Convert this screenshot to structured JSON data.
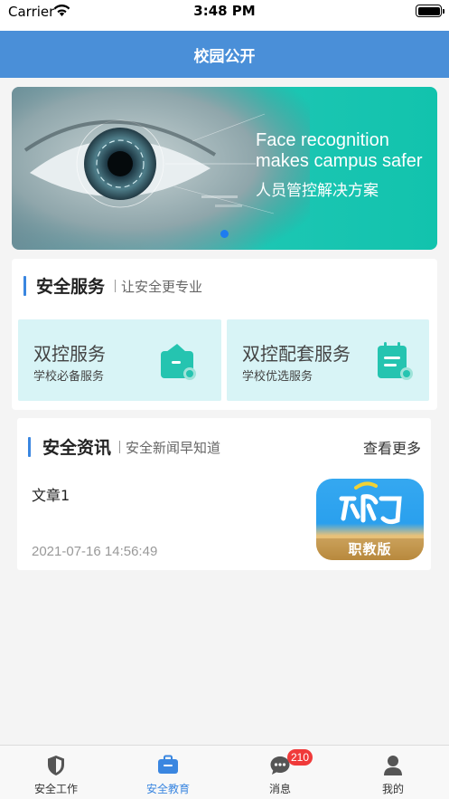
{
  "status_bar": {
    "carrier": "Carrier",
    "time": "3:48 PM"
  },
  "nav": {
    "title": "校园公开"
  },
  "banner": {
    "line1": "Face recognition",
    "line2": "makes campus safer",
    "line3": "人员管控解决方案"
  },
  "service": {
    "title": "安全服务",
    "subtitle": "让安全更专业",
    "items": [
      {
        "name": "双控服务",
        "desc": "学校必备服务",
        "icon": "wallet-icon"
      },
      {
        "name": "双控配套服务",
        "desc": "学校优选服务",
        "icon": "calendar-icon"
      }
    ]
  },
  "news": {
    "title": "安全资讯",
    "subtitle": "安全新闻早知道",
    "more": "查看更多",
    "articles": [
      {
        "title": "文章1",
        "time": "2021-07-16 14:56:49",
        "thumb_label": "职教版"
      }
    ]
  },
  "tabs": [
    {
      "label": "安全工作",
      "icon": "shield-icon"
    },
    {
      "label": "安全教育",
      "icon": "briefcase-icon",
      "active": true
    },
    {
      "label": "消息",
      "icon": "chat-icon",
      "badge": "210"
    },
    {
      "label": "我的",
      "icon": "user-icon"
    }
  ],
  "colors": {
    "nav": "#4a8fd8",
    "accent": "#3a86e0",
    "tile": "#d8f4f6",
    "badge": "#f03a3a"
  }
}
